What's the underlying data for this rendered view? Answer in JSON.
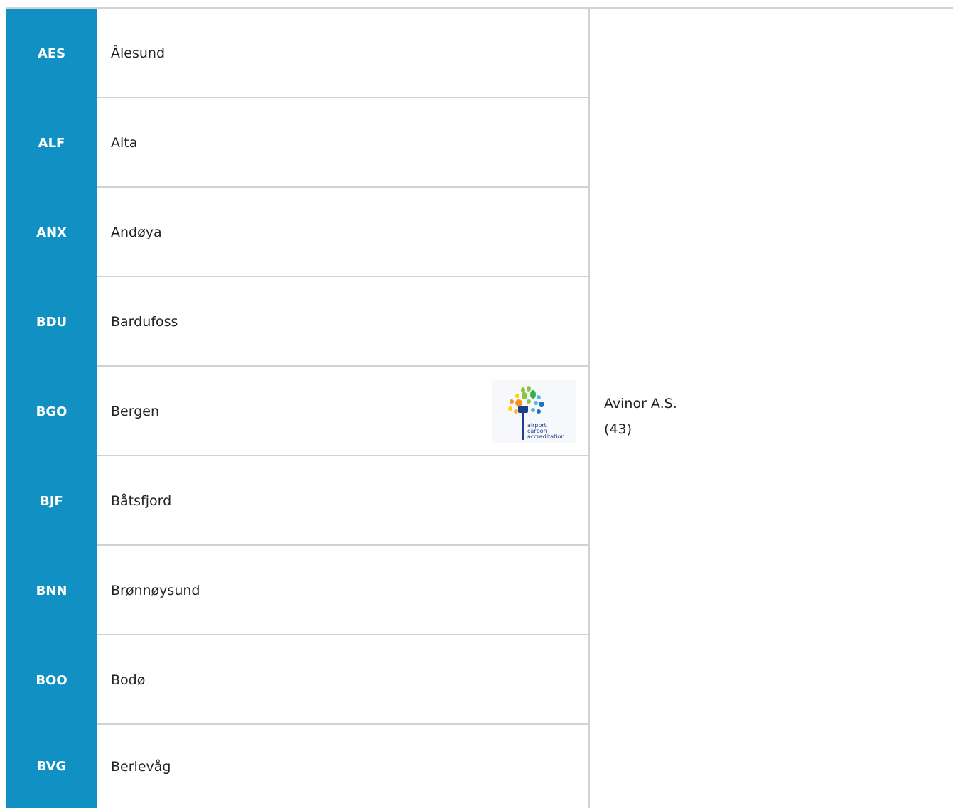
{
  "colors": {
    "code_bg": "#1090c3",
    "divider": "#d2d2d2",
    "text": "#222222"
  },
  "airports": [
    {
      "code": "AES",
      "name": "Ålesund"
    },
    {
      "code": "ALF",
      "name": "Alta"
    },
    {
      "code": "ANX",
      "name": "Andøya"
    },
    {
      "code": "BDU",
      "name": "Bardufoss"
    },
    {
      "code": "BGO",
      "name": "Bergen"
    },
    {
      "code": "BJF",
      "name": "Båtsfjord"
    },
    {
      "code": "BNN",
      "name": "Brønnøysund"
    },
    {
      "code": "BOO",
      "name": "Bodø"
    },
    {
      "code": "BVG",
      "name": "Berlevåg"
    }
  ],
  "badge": {
    "icon": "airport-carbon-accreditation-logo",
    "line1": "airport",
    "line2": "carbon",
    "line3": "accreditation"
  },
  "operator": {
    "name": "Avinor A.S.",
    "count": "(43)"
  }
}
